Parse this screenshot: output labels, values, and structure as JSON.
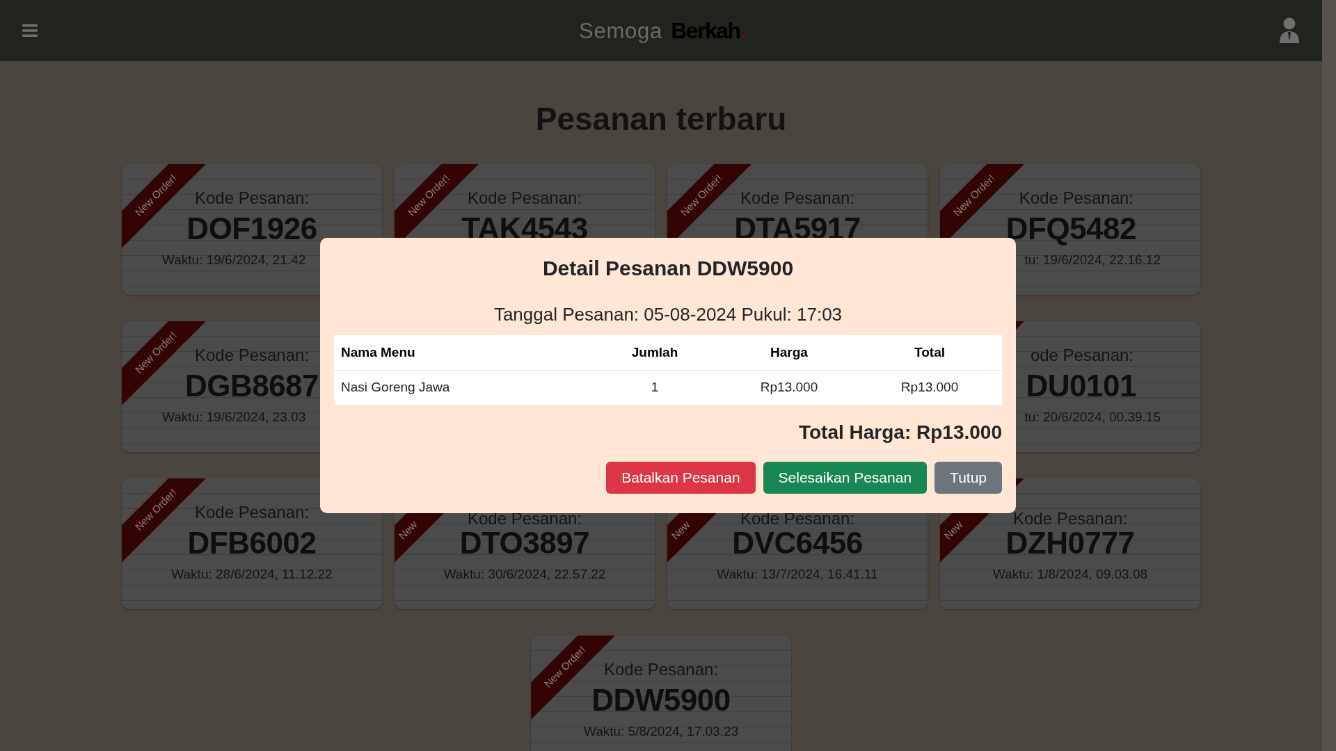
{
  "header": {
    "brand": {
      "light": "Semoga",
      "bold": "Berkah",
      "dot": "."
    }
  },
  "page_title": "Pesanan terbaru",
  "cards": [
    {
      "kind": "cut-right",
      "ribbon": "New Order!",
      "label": "Kode Pesanan:",
      "code": "DOF1926",
      "time": "Waktu: 19/6/2024, 21.42"
    },
    {
      "kind": "order",
      "ribbon": "New Order!",
      "label": "Kode Pesanan:",
      "code": "TAK4543"
    },
    {
      "kind": "order",
      "ribbon": "New Order!",
      "label": "Kode Pesanan:",
      "code": "DTA5917"
    },
    {
      "kind": "cut-left",
      "ribbon": "New Order!",
      "label": "Kode Pesanan:",
      "code": "DFQ5482",
      "time": "tu: 19/6/2024, 22.16.12"
    },
    {
      "kind": "cut-right",
      "ribbon": "New Order!",
      "label": "Kode Pesanan:",
      "code": "DGB8687",
      "time": "Waktu: 19/6/2024, 23.03"
    },
    {
      "kind": "covered"
    },
    {
      "kind": "covered"
    },
    {
      "kind": "cut-left",
      "label": "ode Pesanan:",
      "code": "DU0101",
      "time": "tu: 20/6/2024, 00.39.15"
    },
    {
      "kind": "order",
      "ribbon": "New Order!",
      "label": "Kode Pesanan:",
      "code": "DFB6002",
      "time": "Waktu: 28/6/2024, 11.12.22"
    },
    {
      "kind": "cut-top",
      "ribbon": "New",
      "label": "Kode Pesanan:",
      "code": "DTO3897",
      "time": "Waktu: 30/6/2024, 22.57.22"
    },
    {
      "kind": "cut-top",
      "ribbon": "New",
      "label": "Kode Pesanan:",
      "code": "DVC6456",
      "time": "Waktu: 13/7/2024, 16.41.11"
    },
    {
      "kind": "cut-top",
      "ribbon": "New",
      "label": "Kode Pesanan:",
      "code": "DZH0777",
      "time": "Waktu: 1/8/2024, 09.03.08"
    },
    {
      "kind": "order",
      "ribbon": "New Order!",
      "label": "Kode Pesanan:",
      "code": "DDW5900",
      "time": "Waktu: 5/8/2024, 17.03.23"
    }
  ],
  "modal": {
    "title": "Detail Pesanan DDW5900",
    "date_line": "Tanggal Pesanan: 05-08-2024 Pukul: 17:03",
    "table": {
      "columns": [
        "Nama Menu",
        "Jumlah",
        "Harga",
        "Total"
      ],
      "rows": [
        [
          "Nasi Goreng Jawa",
          "1",
          "Rp13.000",
          "Rp13.000"
        ]
      ]
    },
    "total": "Total Harga: Rp13.000",
    "buttons": [
      {
        "label": "Batalkan Pesanan",
        "kind": "danger"
      },
      {
        "label": "Selesaikan Pesanan",
        "kind": "success"
      },
      {
        "label": "Tutup",
        "kind": "secondary"
      }
    ]
  }
}
